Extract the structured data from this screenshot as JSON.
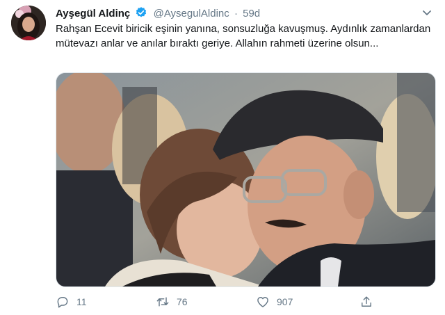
{
  "author": {
    "name": "Ayşegül Aldinç",
    "handle": "@AysegulAldinc",
    "separator": "·",
    "time": "59d"
  },
  "tweet": {
    "text": "Rahşan Ecevit biricik eşinin yanına, sonsuzluğa kavuşmuş. Aydınlık zamanlardan mütevazı anlar ve anılar bıraktı geriye. Allahın rahmeti üzerine olsun..."
  },
  "actions": {
    "reply_count": "11",
    "retweet_count": "76",
    "like_count": "907"
  },
  "icons": {
    "verified": "verified-badge-icon",
    "caret": "chevron-down-icon",
    "reply": "reply-icon",
    "retweet": "retweet-icon",
    "like": "heart-icon",
    "share": "share-icon"
  },
  "colors": {
    "text": "#14171a",
    "secondary": "#657786",
    "verified": "#1da1f2"
  }
}
